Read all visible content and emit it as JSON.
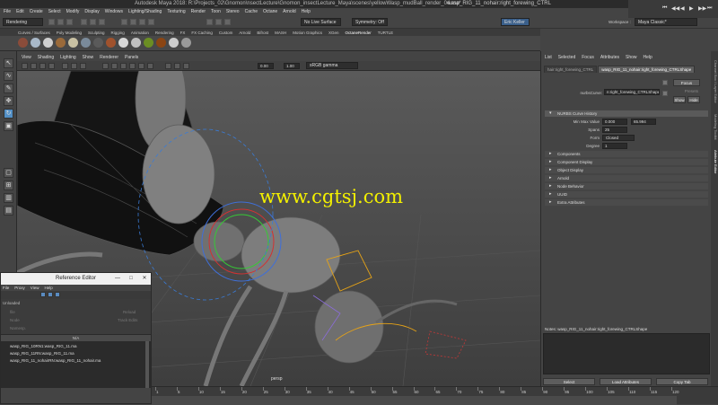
{
  "window": {
    "title": "Autodesk Maya 2018: R:\\Projects_02\\Gnomon\\nsectLecture\\Gnomon_insectLecture_Maya\\scenes\\yellowWasp_mudBall_render_04.ma*",
    "selection_title": "wasp_RIG_11_nohair:right_forewing_CTRL",
    "minimize": "—",
    "maximize": "□",
    "close": "✕"
  },
  "menubar": [
    "File",
    "Edit",
    "Create",
    "Select",
    "Modify",
    "Display",
    "Windows",
    "Lighting/Shading",
    "Texturing",
    "Render",
    "Toon",
    "Stereo",
    "Cache",
    "Octane",
    "Arnold",
    "Help"
  ],
  "statusline": {
    "mode": "Rendering",
    "live_surface": "No Live Surface",
    "symmetry": "Symmetry: Off",
    "user": "Eric Keller",
    "workspace_label": "Workspace :",
    "workspace": "Maya Classic*"
  },
  "shelf_tabs": [
    "Curves / Surfaces",
    "Poly Modeling",
    "Sculpting",
    "Rigging",
    "Animation",
    "Rendering",
    "FX",
    "FX Caching",
    "Custom",
    "Arnold",
    "Bifrost",
    "MASH",
    "Motion Graphics",
    "XGen",
    "OctaneRender",
    "TURTLE"
  ],
  "shelf_active": "OctaneRender",
  "shelf_icon_colors": [
    "#8a4c3a",
    "#a8b8c8",
    "#d0d0d0",
    "#9a6a3a",
    "#c9c1a3",
    "#7a8a9a",
    "#5a5a5a",
    "#a0522d",
    "#d9d9d9",
    "#c0c0c0",
    "#6b8e23",
    "#8b4513",
    "#cccccc",
    "#999999"
  ],
  "viewport_menu": [
    "View",
    "Shading",
    "Lighting",
    "Show",
    "Renderer",
    "Panels"
  ],
  "viewport_fields": {
    "near": "0.00",
    "far": "1.00",
    "colorspace": "sRGB gamma"
  },
  "viewport_camera": "persp",
  "watermark": "www.cgtsj.com",
  "reference_editor": {
    "title": "Reference Editor",
    "menu": [
      "File",
      "Proxy",
      "View",
      "Help"
    ],
    "props": {
      "unloaded": "Unloaded",
      "file": "file",
      "node": "Node",
      "namespace": "Namesp.",
      "reload": "Reload",
      "trackedits": "Track Edits"
    },
    "column_header": "N/A",
    "files": [
      "wasp_RIG_10RN1:wasp_RIG_11.ma",
      "wasp_RIG_11RN:wasp_RIG_11.ma",
      "wasp_RIG_11_nohairRN:wasp_RIG_11_nohair.ma"
    ]
  },
  "attribute_editor": {
    "menu": [
      "List",
      "Selected",
      "Focus",
      "Attributes",
      "Show",
      "Help"
    ],
    "tabs": [
      "hair:right_forewing_CTRL",
      "wasp_RIG_11_nohair:right_forewing_CTRLShape"
    ],
    "active_tab": "wasp_RIG_11_nohair:right_forewing_CTRLShape",
    "nurbs_label": "nurbsCurve:",
    "nurbs_value": "n:right_forewing_CTRLShape",
    "focus": "Focus",
    "presets": "Presets",
    "show": "Show",
    "hide": "Hide",
    "history_section": "NURBS Curve History",
    "min_max_label": "Min Max Value",
    "min_value": "0.000",
    "max_value": "65.994",
    "spans_label": "Spans",
    "spans_value": "25",
    "form_label": "Form",
    "form_value": "Closed",
    "degree_label": "Degree",
    "degree_value": "1",
    "sections": [
      "Components",
      "Component Display",
      "Object Display",
      "Arnold",
      "Node Behavior",
      "UUID",
      "Extra Attributes"
    ],
    "notes_label": "Notes:",
    "notes_node": "wasp_RIG_11_nohair:right_forewing_CTRLShape",
    "select": "Select",
    "load_attributes": "Load Attributes",
    "copy_tab": "Copy Tab"
  },
  "side_tabs": [
    "Channel Box / Layer Editor",
    "Modeling Toolkit",
    "Attribute Editor"
  ],
  "timeline": {
    "ticks": [
      "1",
      "5",
      "10",
      "15",
      "20",
      "25",
      "30",
      "35",
      "40",
      "45",
      "50",
      "55",
      "60",
      "65",
      "70",
      "75",
      "80",
      "85",
      "90",
      "95",
      "100",
      "105",
      "110",
      "115",
      "120"
    ]
  },
  "playback": [
    "⏮",
    "◀◀",
    "◀",
    "▶",
    "▶▶",
    "⏭"
  ]
}
